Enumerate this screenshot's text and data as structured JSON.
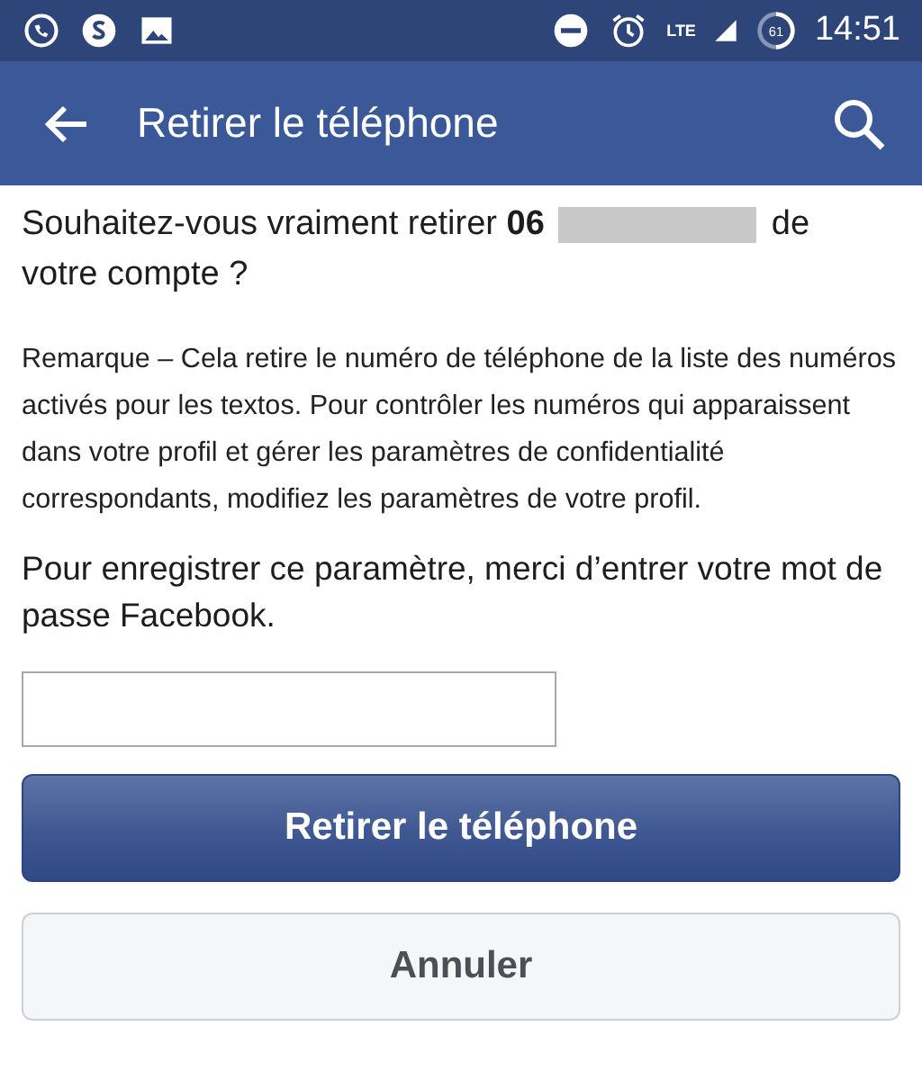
{
  "status_bar": {
    "network": "LTE",
    "battery": "61",
    "time": "14:51"
  },
  "app_bar": {
    "title": "Retirer le téléphone"
  },
  "question": {
    "before": "Souhaitez-vous vraiment retirer **06**",
    "after": [
      "de",
      "votre compte ?"
    ]
  },
  "note": "Remarque – Cela retire le numéro de téléphone de la liste des numéros activés pour les textos. Pour contrôler les numéros qui apparaissent dans votre profil et gérer les paramètres de confidentialité correspondants, modifiez les paramètres de votre profil.",
  "password_prompt": "Pour enregistrer ce paramètre, merci d’entrer votre mot de passe Facebook.",
  "buttons": [
    {
      "label": "Retirer le téléphone",
      "kind": "primary"
    },
    {
      "label": "Annuler",
      "kind": "secondary"
    }
  ]
}
